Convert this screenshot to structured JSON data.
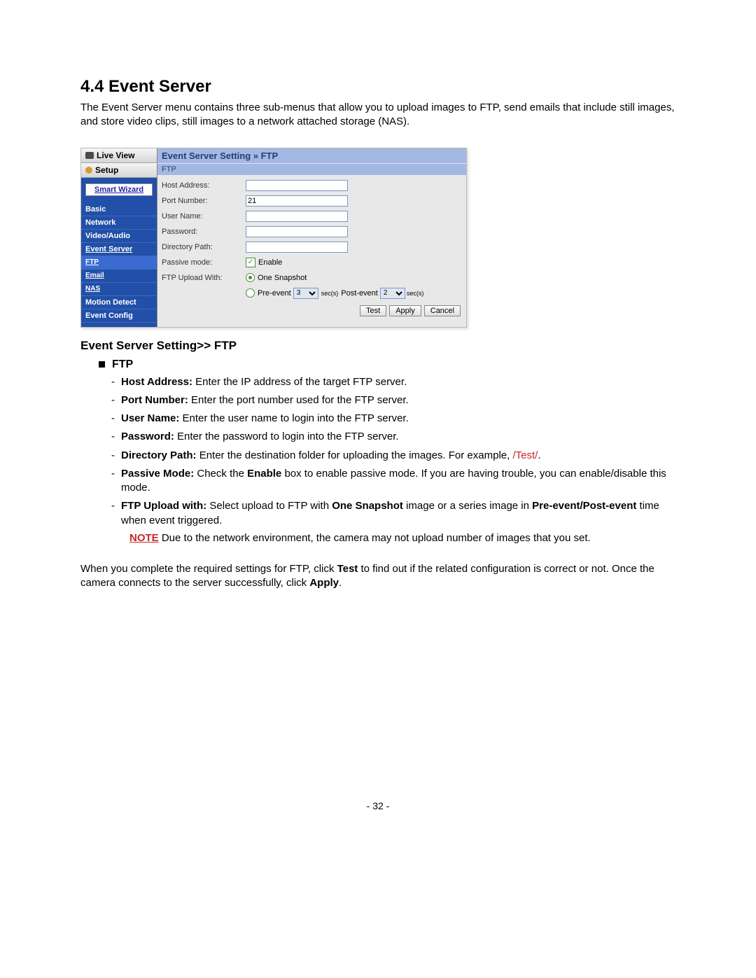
{
  "heading": "4.4  Event Server",
  "intro": "The Event Server menu contains three sub-menus that allow you to upload images to FTP, send emails that include still images, and store video clips, still images to a network attached storage (NAS).",
  "sidebar": {
    "live_view": "Live View",
    "setup": "Setup",
    "smart_wizard": "Smart Wizard",
    "items": [
      "Basic",
      "Network",
      "Video/Audio",
      "Event Server"
    ],
    "subitems": [
      "FTP",
      "Email",
      "NAS"
    ],
    "items2": [
      "Motion Detect",
      "Event Config"
    ]
  },
  "panel": {
    "title": "Event Server Setting » FTP",
    "subtitle": "FTP",
    "labels": {
      "host": "Host Address:",
      "port": "Port Number:",
      "user": "User Name:",
      "pass": "Password:",
      "dir": "Directory Path:",
      "passive": "Passive mode:",
      "upload": "FTP Upload With:"
    },
    "values": {
      "port": "21"
    },
    "enable": "Enable",
    "one_snapshot": "One Snapshot",
    "pre_event": "Pre-event",
    "post_event": "Post-event",
    "secs": "sec(s)",
    "preval": "3",
    "postval": "2",
    "buttons": {
      "test": "Test",
      "apply": "Apply",
      "cancel": "Cancel"
    }
  },
  "subsection": "Event Server Setting>> FTP",
  "ftp_heading": "FTP",
  "items": {
    "host_b": "Host Address:",
    "host_t": " Enter the IP address of the target FTP server.",
    "port_b": "Port Number:",
    "port_t": " Enter the port number used for the FTP server.",
    "user_b": "User Name:",
    "user_t": " Enter the user name to login into the FTP server.",
    "pass_b": "Password:",
    "pass_t": " Enter the password to login into the FTP server.",
    "dir_b": "Directory Path:",
    "dir_t": " Enter the destination folder for uploading the images. For example, ",
    "dir_red": "/Test/",
    "passive_b": "Passive Mode:",
    "passive_t1": " Check the ",
    "passive_enable_b": "Enable",
    "passive_t2": " box to enable passive mode.  If you are having trouble, you can enable/disable this mode.",
    "upload_b": "FTP Upload with:",
    "upload_t1": " Select upload to FTP with ",
    "upload_snap_b": "One Snapshot",
    "upload_t2": " image or a series image in ",
    "upload_pre_b": "Pre-event/Post-event",
    "upload_t3": " time when event triggered."
  },
  "note_label": "NOTE",
  "note_text": "   Due to the network environment, the camera may not upload number of images that you set.",
  "closing1": "When you complete the required settings for FTP, click ",
  "closing_test": "Test",
  "closing2": " to find out if the related configuration is correct or not. Once the camera connects to the server successfully, click ",
  "closing_apply": "Apply",
  "closing3": ".",
  "page_number": "- 32 -"
}
